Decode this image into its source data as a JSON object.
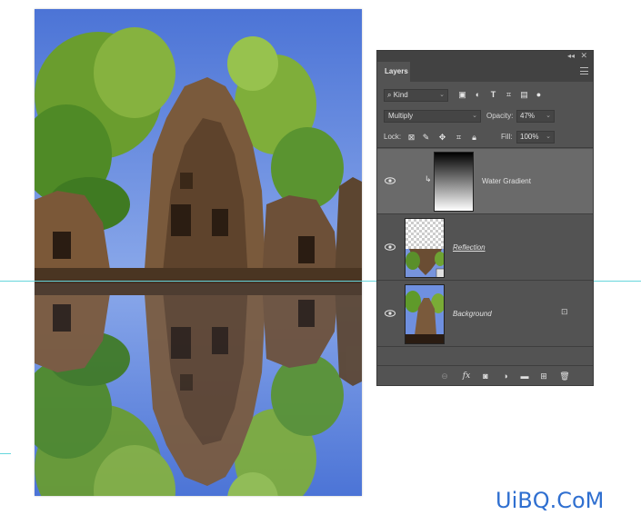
{
  "panel": {
    "tab_label": "Layers",
    "filter": {
      "label": "Kind"
    },
    "blend_mode": "Multiply",
    "opacity_label": "Opacity:",
    "opacity_value": "47%",
    "lock_label": "Lock:",
    "fill_label": "Fill:",
    "fill_value": "100%",
    "layers": [
      {
        "name": "Water Gradient",
        "selected": true,
        "clipped": true,
        "thumb": "gradient-black-white"
      },
      {
        "name": "Reflection",
        "selected": false,
        "style": "italic-underline",
        "thumb": "transparent+photo"
      },
      {
        "name": "Background",
        "selected": false,
        "style": "italic",
        "locked": true,
        "thumb": "photo"
      }
    ]
  },
  "watermark": "UiBQ.CoM",
  "colors": {
    "panel_bg": "#535353",
    "panel_dark": "#424242",
    "selected_row": "#6a6a6a",
    "guide": "#66d6dc",
    "sky": "#6e90e0",
    "foliage": "#5f9a2a",
    "stone": "#6e4e33",
    "watermark": "#2f6fd0"
  },
  "icons": [
    "eye-icon",
    "search-icon",
    "image-filter-icon",
    "adjustment-filter-icon",
    "type-filter-icon",
    "shape-filter-icon",
    "smart-object-filter-icon",
    "filter-toggle-icon",
    "lock-transparent-icon",
    "lock-paint-icon",
    "lock-position-icon",
    "lock-artboard-icon",
    "lock-all-icon",
    "link-icon",
    "fx-icon",
    "mask-icon",
    "adjustment-layer-icon",
    "group-folder-icon",
    "new-layer-icon",
    "trash-icon",
    "padlock-icon",
    "clip-arrow-icon"
  ]
}
